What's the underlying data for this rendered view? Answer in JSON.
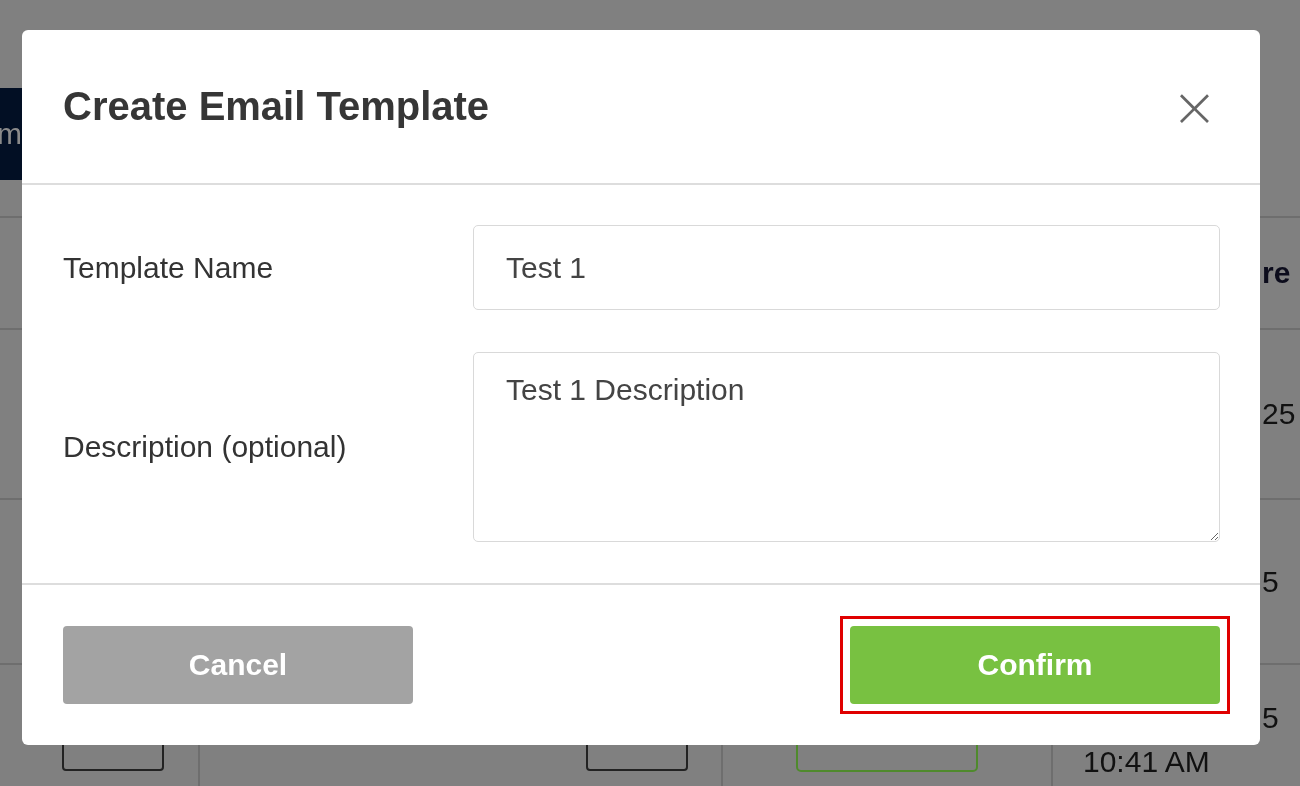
{
  "background": {
    "side_button": "m",
    "column_header": "re",
    "cells": [
      "25",
      "5",
      "5"
    ],
    "time": "10:41 AM"
  },
  "dialog": {
    "title": "Create Email Template",
    "close_glyph": "×",
    "fields": [
      {
        "kind": "input",
        "label": "Template Name",
        "value": "Test 1"
      },
      {
        "kind": "textarea",
        "label": "Description (optional)",
        "value": "Test 1 Description"
      }
    ],
    "buttons": [
      {
        "kind": "cancel",
        "label": "Cancel",
        "highlighted": false
      },
      {
        "kind": "confirm",
        "label": "Confirm",
        "highlighted": true
      }
    ]
  }
}
